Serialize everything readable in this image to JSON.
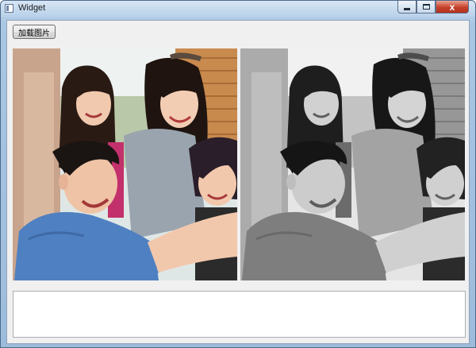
{
  "window": {
    "title": "Widget",
    "close_glyph": "x"
  },
  "toolbar": {
    "load_image_label": "加载图片"
  },
  "images": {
    "original_icon": "photo-color",
    "processed_icon": "photo-grayscale"
  },
  "output": {
    "text": ""
  }
}
